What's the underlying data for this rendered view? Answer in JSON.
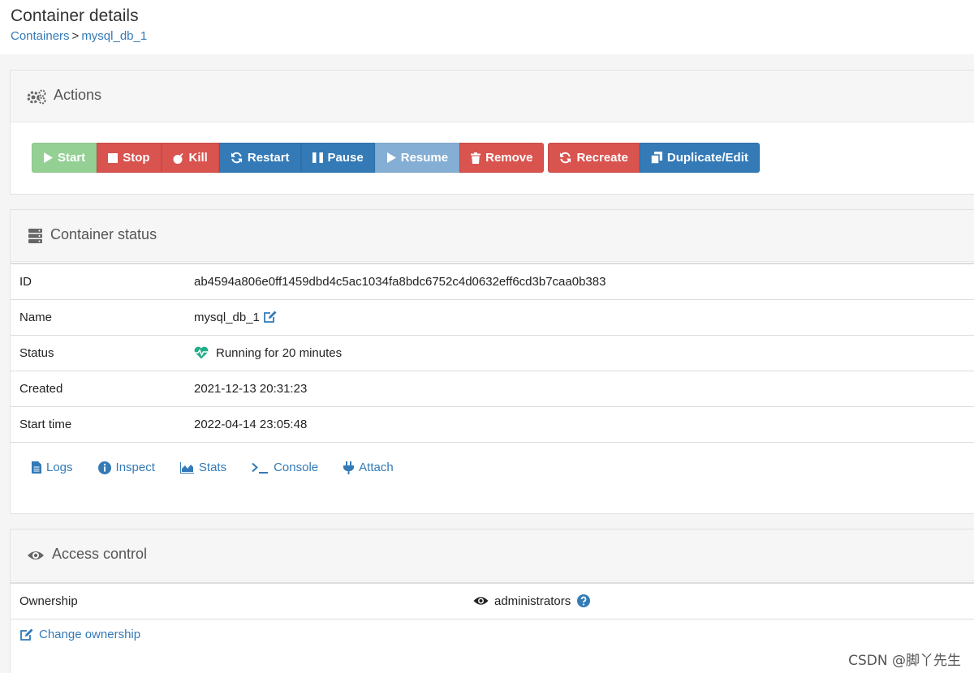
{
  "header": {
    "title": "Container details",
    "breadcrumb": [
      "Containers",
      "mysql_db_1"
    ],
    "breadcrumb_separator": ">"
  },
  "actions": {
    "title": "Actions",
    "icon": "gears-icon",
    "buttons": [
      "Start",
      "Stop",
      "Kill",
      "Restart",
      "Pause",
      "Resume",
      "Remove",
      "Recreate",
      "Duplicate/Edit"
    ]
  },
  "status": {
    "title": "Container status",
    "icon": "server-icon",
    "rows": [
      {
        "label": "ID",
        "value": "ab4594a806e0ff1459dbd4c5ac1034fa8bdc6752c4d0632eff6cd3b7caa0b383"
      },
      {
        "label": "Name",
        "value": "mysql_db_1"
      },
      {
        "label": "Status",
        "value": "Running for 20 minutes"
      },
      {
        "label": "Created",
        "value": "2021-12-13 20:31:23"
      },
      {
        "label": "Start time",
        "value": "2022-04-14 23:05:48"
      }
    ],
    "links": [
      "Logs",
      "Inspect",
      "Stats",
      "Console",
      "Attach"
    ]
  },
  "access": {
    "title": "Access control",
    "icon": "eye-icon",
    "ownership_label": "Ownership",
    "ownership_value": "administrators",
    "change_ownership": "Change ownership"
  },
  "watermark": "CSDN @脚丫先生",
  "colors": {
    "success": "#5cb85c",
    "danger": "#d9534f",
    "primary": "#337ab7",
    "status_running": "#23ae89"
  }
}
